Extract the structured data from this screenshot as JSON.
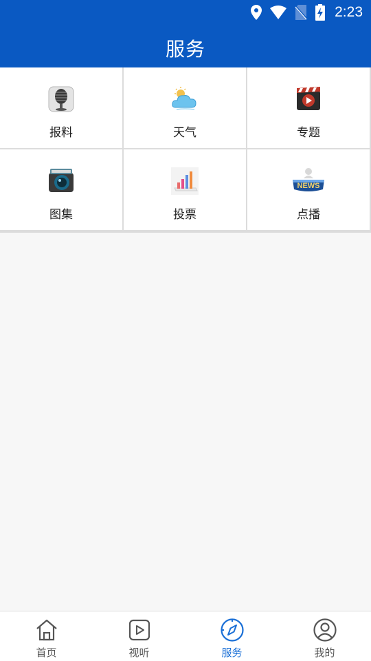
{
  "status_bar": {
    "time": "2:23",
    "icons": [
      "location-icon",
      "wifi-icon",
      "no-sim-icon",
      "battery-charging-icon"
    ]
  },
  "header": {
    "title": "服务"
  },
  "services": [
    {
      "label": "报料",
      "icon": "microphone-icon"
    },
    {
      "label": "天气",
      "icon": "weather-cloud-icon"
    },
    {
      "label": "专题",
      "icon": "film-clapper-icon"
    },
    {
      "label": "图集",
      "icon": "camera-icon"
    },
    {
      "label": "投票",
      "icon": "bar-chart-icon"
    },
    {
      "label": "点播",
      "icon": "news-icon"
    }
  ],
  "tabbar": {
    "items": [
      {
        "label": "首页",
        "icon": "home-icon"
      },
      {
        "label": "视听",
        "icon": "play-icon"
      },
      {
        "label": "服务",
        "icon": "compass-icon",
        "active": true
      },
      {
        "label": "我的",
        "icon": "profile-icon"
      }
    ]
  },
  "colors": {
    "brand": "#0a59c2",
    "active_tab": "#1a6fd6",
    "inactive_tab": "#555555"
  }
}
